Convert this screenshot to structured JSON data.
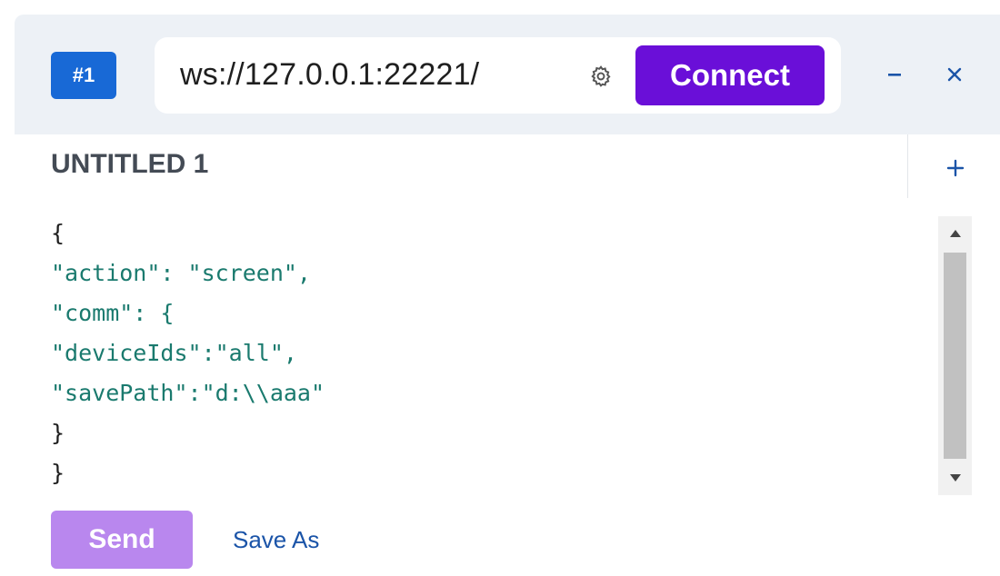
{
  "connection": {
    "badge": "#1",
    "url": "ws://127.0.0.1:22221/",
    "settings_icon": "gear-icon",
    "connect_label": "Connect"
  },
  "window_controls": {
    "minimize_icon": "minus-icon",
    "close_icon": "close-icon"
  },
  "tab": {
    "title": "UNTITLED 1",
    "add_icon": "plus-icon"
  },
  "editor": {
    "lines": [
      "{",
      "\"action\": \"screen\",",
      "\"comm\": {",
      "\"deviceIds\":\"all\",",
      "\"savePath\":\"d:\\\\aaa\"",
      "}",
      "}"
    ]
  },
  "actions": {
    "send_label": "Send",
    "save_as_label": "Save As"
  },
  "colors": {
    "accent": "#6a0fd8",
    "badge": "#1869d6",
    "send_disabled": "#b987ee",
    "link": "#1b54a8",
    "json_key": "#1a7a6e"
  }
}
